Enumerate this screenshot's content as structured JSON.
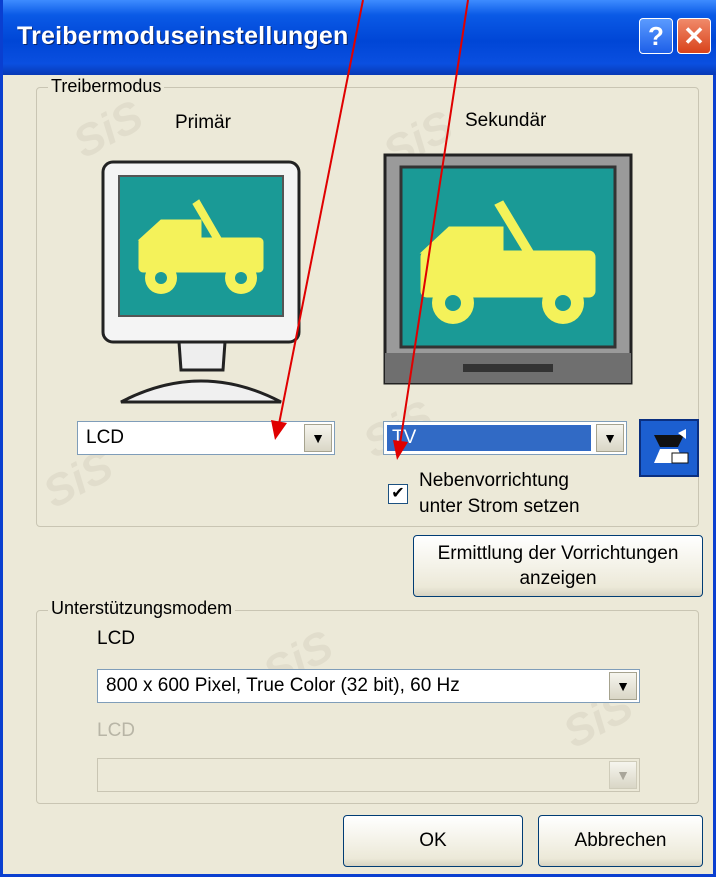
{
  "window": {
    "title": "Treibermoduseinstellungen",
    "help_glyph": "?",
    "close_glyph": "✕"
  },
  "watermark": "SiS",
  "driver_mode": {
    "legend": "Treibermodus",
    "primary_label": "Primär",
    "secondary_label": "Sekundär",
    "primary_select": "LCD",
    "secondary_select": "TV",
    "power_checkbox": {
      "checked": true,
      "label_line1": "Nebenvorrichtung",
      "label_line2": "unter Strom setzen"
    }
  },
  "detect_button": {
    "line1": "Ermittlung der Vorrichtungen",
    "line2": "anzeigen"
  },
  "support_modes": {
    "legend": "Unterstützungsmodem",
    "primary_label": "LCD",
    "primary_mode": "800 x 600 Pixel, True Color (32 bit), 60 Hz",
    "secondary_label": "LCD",
    "secondary_mode": ""
  },
  "ok_label": "OK",
  "cancel_label": "Abbrechen",
  "colors": {
    "title_bar": "#0046d6",
    "screen": "#1a9a96",
    "jeep": "#f4f25a",
    "selection": "#316ac5",
    "arrow": "#e00000"
  }
}
